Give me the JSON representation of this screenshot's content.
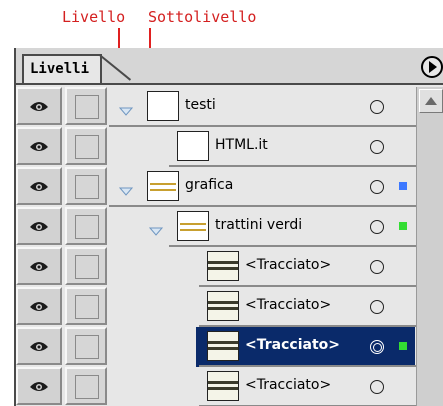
{
  "annotations": {
    "livello": "Livello",
    "sottolivello": "Sottolivello"
  },
  "panel": {
    "tab_label": "Livelli",
    "menu_icon": "triangle-right-circle-icon"
  },
  "layers": [
    {
      "name": "testi",
      "level": 0,
      "expanded": true,
      "thumbnail": "blank",
      "selection_color": null,
      "selected": false
    },
    {
      "name": "HTML.it",
      "level": 1,
      "expanded": null,
      "thumbnail": "blank",
      "selection_color": null,
      "selected": false
    },
    {
      "name": "grafica",
      "level": 0,
      "expanded": true,
      "thumbnail": "artwork",
      "selection_color": "#3c78ff",
      "selected": false
    },
    {
      "name": "trattini verdi",
      "level": 1,
      "expanded": true,
      "thumbnail": "artwork",
      "selection_color": "#33dd33",
      "selected": false
    },
    {
      "name": "<Tracciato>",
      "level": 2,
      "expanded": null,
      "thumbnail": "path",
      "selection_color": null,
      "selected": false
    },
    {
      "name": "<Tracciato>",
      "level": 2,
      "expanded": null,
      "thumbnail": "path",
      "selection_color": null,
      "selected": false
    },
    {
      "name": "<Tracciato>",
      "level": 2,
      "expanded": null,
      "thumbnail": "path",
      "selection_color": "#33dd33",
      "selected": true
    },
    {
      "name": "<Tracciato>",
      "level": 2,
      "expanded": null,
      "thumbnail": "path",
      "selection_color": null,
      "selected": false
    }
  ],
  "colors": {
    "annotation": "#d42020",
    "selection_bg": "#0a2a6a",
    "disclosure": "#8fb3d8"
  }
}
